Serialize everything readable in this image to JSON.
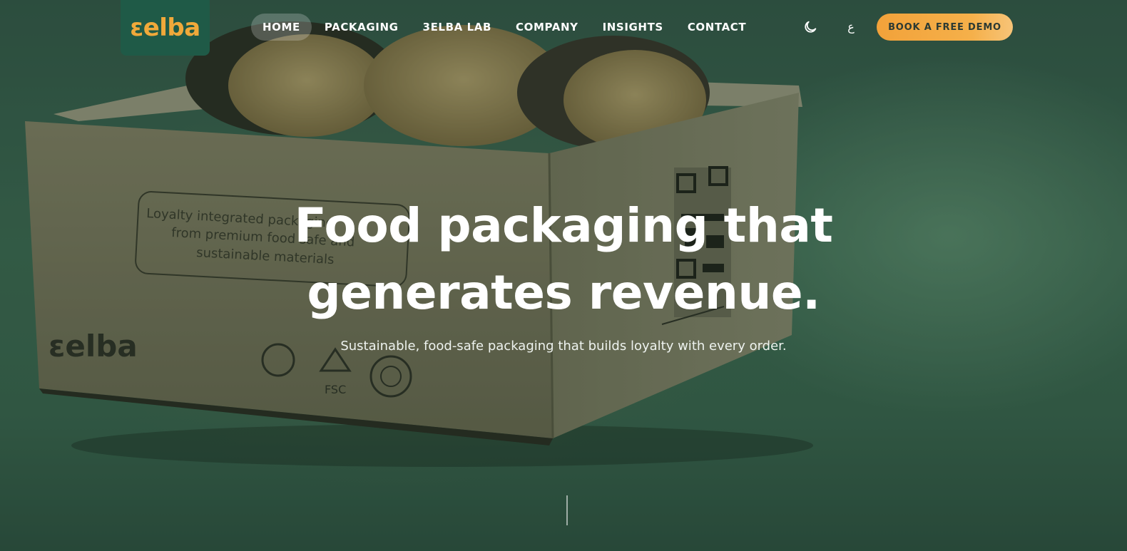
{
  "brand": {
    "logo_text": "ɛelba",
    "tile_color": "#1f5a47",
    "logo_color": "#f0a93a"
  },
  "nav": {
    "items": [
      {
        "label": "HOME",
        "active": true
      },
      {
        "label": "PACKAGING"
      },
      {
        "label": "3ELBA LAB"
      },
      {
        "label": "COMPANY"
      },
      {
        "label": "INSIGHTS"
      },
      {
        "label": "CONTACT"
      }
    ],
    "theme_icon": "moon-icon",
    "language_label": "ع",
    "cta_label": "BOOK A FREE DEMO",
    "cta_color": "#f2a23a"
  },
  "hero": {
    "headline_line1": "Food packaging that",
    "headline_line2": "generates revenue.",
    "subheadline": "Sustainable, food-safe packaging that builds loyalty with every order.",
    "background_color": "#3f6a53"
  },
  "photo": {
    "box_print_text_1": "Loyalty integrated packaging",
    "box_print_text_2": "from premium food safe and",
    "box_print_text_3": "sustainable materials",
    "box_logo": "ɛelba",
    "fsc_label": "FSC"
  }
}
